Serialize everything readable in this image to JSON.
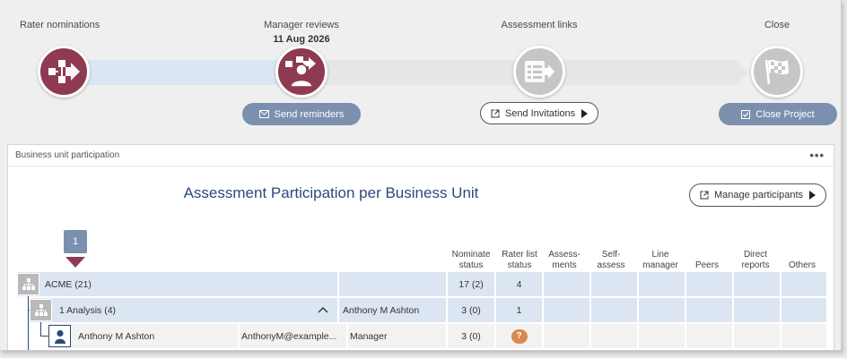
{
  "stages": [
    {
      "label": "Rater nominations",
      "date": "",
      "icon": "org-chart-arrow-icon"
    },
    {
      "label": "Manager reviews",
      "date": "11 Aug 2026",
      "icon": "manager-review-icon"
    },
    {
      "label": "Assessment links",
      "date": "",
      "icon": "assessment-list-icon"
    },
    {
      "label": "Close",
      "date": "",
      "icon": "checkered-flag-icon"
    }
  ],
  "actions": {
    "send_reminders": "Send reminders",
    "send_invitations": "Send Invitations",
    "close_project": "Close Project"
  },
  "panel": {
    "title": "Business unit participation",
    "menu": "•••",
    "heading": "Assessment Participation per Business Unit",
    "manage_participants": "Manage participants",
    "level": "1"
  },
  "columns": [
    "Nominate status",
    "Rater list status",
    "Assess- ments",
    "Self- assess",
    "Line manager",
    "Peers",
    "Direct reports",
    "Others"
  ],
  "rows": [
    {
      "name": "ACME (21)",
      "col2": "",
      "col3": "",
      "nominate": "17 (2)",
      "raterlist": "4"
    },
    {
      "name": "1 Analysis (4)",
      "col2": "",
      "col3": "Anthony M Ashton",
      "nominate": "3 (0)",
      "raterlist": "1"
    },
    {
      "name": "Anthony M Ashton",
      "col2": "AnthonyM@example...",
      "col3": "Manager",
      "nominate": "3 (0)",
      "raterlist": "?"
    }
  ],
  "colors": {
    "accent_red": "#8f3a52",
    "accent_blue": "#7b90ae",
    "row_blue": "#dbe6f2",
    "title_blue": "#2c4a78",
    "badge_orange": "#d9894d"
  }
}
